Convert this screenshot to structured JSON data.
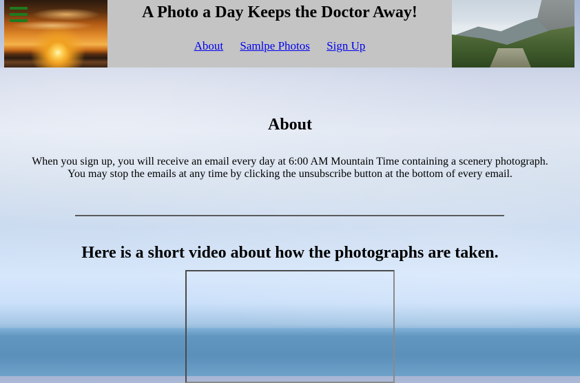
{
  "header": {
    "title": "A Photo a Day Keeps the Doctor Away!",
    "nav": [
      {
        "label": "About"
      },
      {
        "label": "Samlpe Photos"
      },
      {
        "label": "Sign Up"
      }
    ],
    "menu_icon": "hamburger-menu-icon",
    "left_image": "sunset-photo",
    "right_image": "mountain-valley-photo"
  },
  "about": {
    "heading": "About",
    "line1": "When you sign up, you will receive an email every day at 6:00 AM Mountain Time containing a scenery photograph.",
    "line2": "You may stop the emails at any time by clicking the unsubscribe button at the bottom of every email."
  },
  "video": {
    "heading": "Here is a short video about how the photographs are taken."
  },
  "colors": {
    "header_bg": "#c4c4c4",
    "link": "#0000ee",
    "menu_icon": "#1f7a1f"
  }
}
